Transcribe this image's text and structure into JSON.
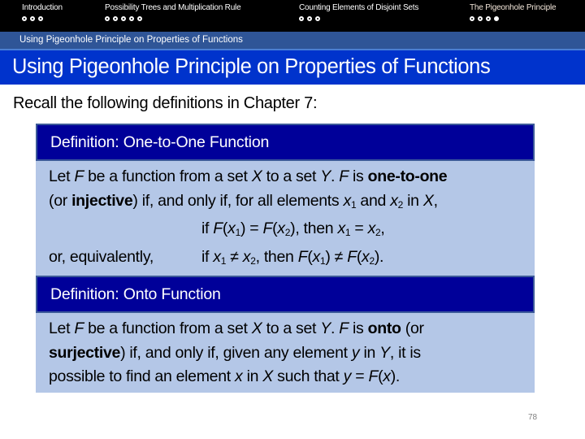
{
  "nav": {
    "sections": [
      {
        "title": "Introduction",
        "dots": 3,
        "filled_index": -1,
        "active": false
      },
      {
        "title": "Possibility Trees and Multiplication Rule",
        "dots": 5,
        "filled_index": -1,
        "active": false
      },
      {
        "title": "Counting Elements of Disjoint Sets",
        "dots": 3,
        "filled_index": -1,
        "active": false
      },
      {
        "title": "The Pigeonhole Principle",
        "dots": 4,
        "filled_index": 3,
        "active": true
      }
    ],
    "icon": "progress-dot-icon"
  },
  "subsection": "Using Pigeonhole Principle on Properties of Functions",
  "title": "Using Pigeonhole Principle on Properties of Functions",
  "intro": "Recall the following definitions in Chapter 7:",
  "definitions": [
    {
      "heading": "Definition: One-to-One Function",
      "l1": {
        "a": "Let ",
        "F1": "F",
        "b": " be a function from a set ",
        "X": "X",
        "c": " to a set ",
        "Y": "Y",
        "d": ". ",
        "F2": "F",
        "e": " is ",
        "bold": "one-to-one"
      },
      "l2": {
        "a": "(or ",
        "bold": "injective",
        "b": ") if, and only if, for all elements ",
        "x1": "x",
        "s1": "1",
        "c": " and ",
        "x2": "x",
        "s2": "2",
        "d": " in ",
        "X": "X",
        "e": ","
      },
      "l3": {
        "a": "if ",
        "F1": "F",
        "b": "(",
        "x1": "x",
        "s1": "1",
        "c": ") = ",
        "F2": "F",
        "d": "(",
        "x2": "x",
        "s2": "2",
        "e": "), then ",
        "x3": "x",
        "s3": "1",
        "f": " = ",
        "x4": "x",
        "s4": "2",
        "g": ","
      },
      "l4": {
        "label": "or, equivalently,",
        "a": "if ",
        "x1": "x",
        "s1": "1",
        "b": " ≠ ",
        "x2": "x",
        "s2": "2",
        "c": ", then ",
        "F1": "F",
        "d": "(",
        "x3": "x",
        "s3": "1",
        "e": ") ≠ ",
        "F2": "F",
        "f": "(",
        "x4": "x",
        "s4": "2",
        "g": ")."
      }
    },
    {
      "heading": "Definition: Onto Function",
      "l1": {
        "a": "Let ",
        "F1": "F",
        "b": " be a function from a set ",
        "X": "X",
        "c": " to a set ",
        "Y": "Y",
        "d": ". ",
        "F2": "F",
        "e": " is ",
        "bold": "onto",
        "f": " (or"
      },
      "l2": {
        "bold": "surjective",
        "a": ") if, and only if, given any element ",
        "y": "y",
        "b": " in ",
        "Y": "Y",
        "c": ", it is"
      },
      "l3": {
        "a": "possible to find an element ",
        "x": "x",
        "b": " in ",
        "X": "X",
        "c": " such that ",
        "y": "y",
        "d": " = ",
        "F": "F",
        "e": "(",
        "x2": "x",
        "f": ")."
      }
    }
  ],
  "page_number": "78",
  "colors": {
    "nav_bg": "#000000",
    "subbar_bg": "#2f5597",
    "title_bg": "#0033cc",
    "def_head_bg": "#000099",
    "def_body_bg": "#b4c7e7"
  }
}
